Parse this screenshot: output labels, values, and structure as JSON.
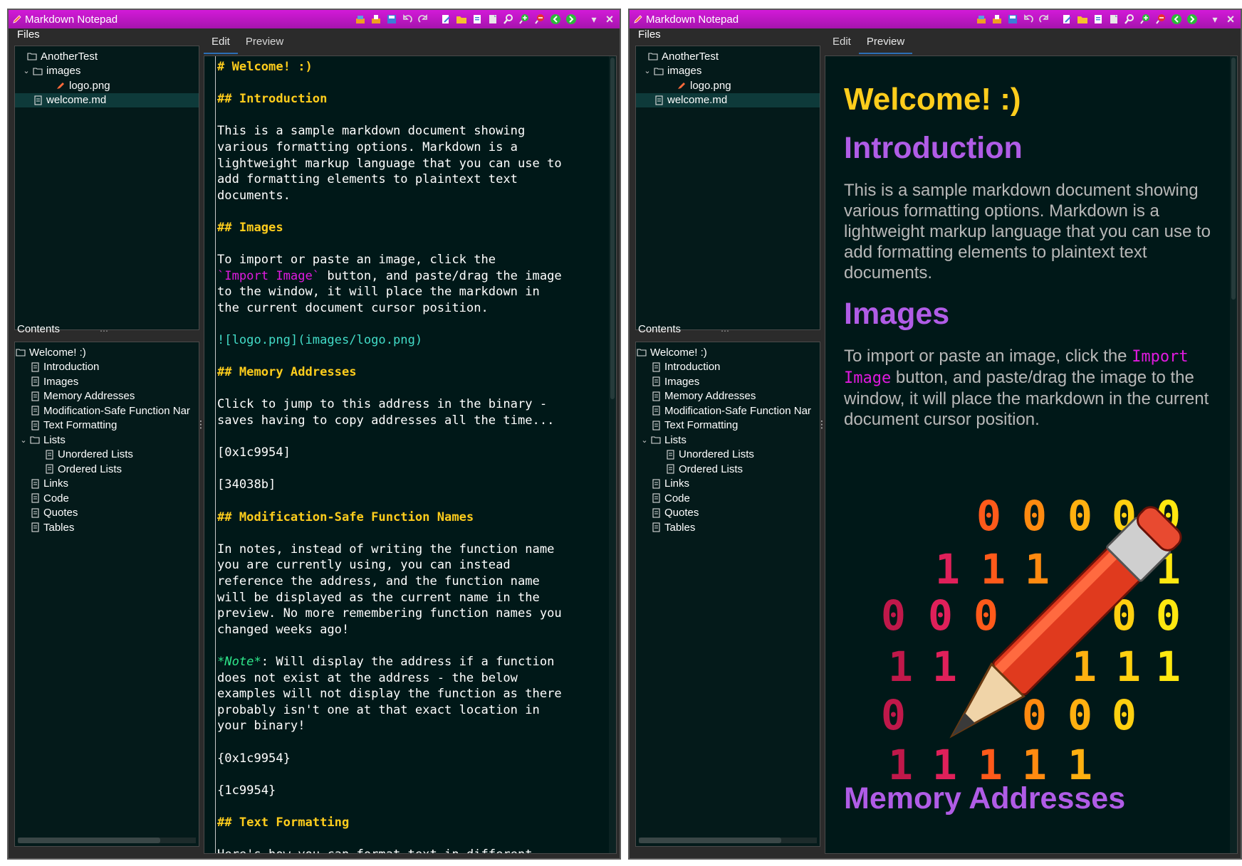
{
  "app": {
    "title": "Markdown Notepad"
  },
  "colors": {
    "titlebar": "#c818cf",
    "panel_bg": "#041a1a",
    "heading_yellow": "#ffcd1c",
    "heading_purple": "#b05ce6",
    "inline_code": "#e01ae0",
    "image_link": "#42dcc8",
    "note_green": "#2ee68a"
  },
  "toolbar_icons": [
    "import-image-icon",
    "import-file-icon",
    "save-icon",
    "undo-icon",
    "redo-icon",
    "edit-icon",
    "open-folder-icon",
    "new-document-icon",
    "document-icon",
    "search-icon",
    "zoom-in-icon",
    "zoom-out-icon",
    "back-icon",
    "forward-icon"
  ],
  "files": {
    "label": "Files",
    "tree": [
      {
        "label": "AnotherTest",
        "icon": "folder-icon"
      },
      {
        "label": "images",
        "icon": "folder-icon"
      },
      {
        "label": "logo.png",
        "icon": "image-file-icon"
      },
      {
        "label": "welcome.md",
        "icon": "document-icon"
      }
    ]
  },
  "contents": {
    "label": "Contents",
    "tree": [
      {
        "label": "Welcome! :)"
      },
      {
        "label": "Introduction"
      },
      {
        "label": "Images"
      },
      {
        "label": "Memory Addresses"
      },
      {
        "label": "Modification-Safe Function Nar"
      },
      {
        "label": "Text Formatting"
      },
      {
        "label": "Lists"
      },
      {
        "label": "Unordered Lists"
      },
      {
        "label": "Ordered Lists"
      },
      {
        "label": "Links"
      },
      {
        "label": "Code"
      },
      {
        "label": "Quotes"
      },
      {
        "label": "Tables"
      }
    ]
  },
  "tabs": {
    "edit": "Edit",
    "preview": "Preview"
  },
  "left_window": {
    "active_tab": "Edit"
  },
  "right_window": {
    "active_tab": "Preview"
  },
  "source": {
    "h1": "# Welcome! :)",
    "h_intro": "## Introduction",
    "intro_lines": "This is a sample markdown document showing\nvarious formatting options. Markdown is a\nlightweight markup language that you can use to\nadd formatting elements to plaintext text\ndocuments.",
    "h_images": "## Images",
    "images_line1": "To import or paste an image, click the",
    "images_code": "`Import Image`",
    "images_line2_rest": " button, and paste/drag the image",
    "images_line3": "to the window, it will place the markdown in\nthe current document cursor position.",
    "image_link": "![logo.png](images/logo.png)",
    "h_memory": "## Memory Addresses",
    "memory_lines": "Click to jump to this address in the binary -\nsaves having to copy addresses all the time...",
    "addr1": "[0x1c9954]",
    "addr2": "[34038b]",
    "h_modsafe": "## Modification-Safe Function Names",
    "modsafe_lines": "In notes, instead of writing the function name\nyou are currently using, you can instead\nreference the address, and the function name\nwill be displayed as the current name in the\npreview. No more remembering function names you\nchanged weeks ago!",
    "note": "*Note*",
    "note_rest": ": Will display the address if a function",
    "note_lines": "does not exist at the address - the below\nexamples will not display the function as there\nprobably isn't one at that exact location in\nyour binary!",
    "func1": "{0x1c9954}",
    "func2": "{1c9954}",
    "h_textfmt": "## Text Formatting",
    "textfmt_line": "Here's how you can format text in different"
  },
  "preview": {
    "h1": "Welcome! :)",
    "h_intro": "Introduction",
    "intro": "This is a sample markdown document showing various formatting options. Markdown is a lightweight markup language that you can use to add formatting elements to plaintext text documents.",
    "h_images": "Images",
    "images_before": "To import or paste an image, click the ",
    "images_code": "Import Image",
    "images_after": " button, and paste/drag the image to the window, it will place the markdown in the current document cursor position.",
    "h_memory": "Memory Addresses"
  }
}
